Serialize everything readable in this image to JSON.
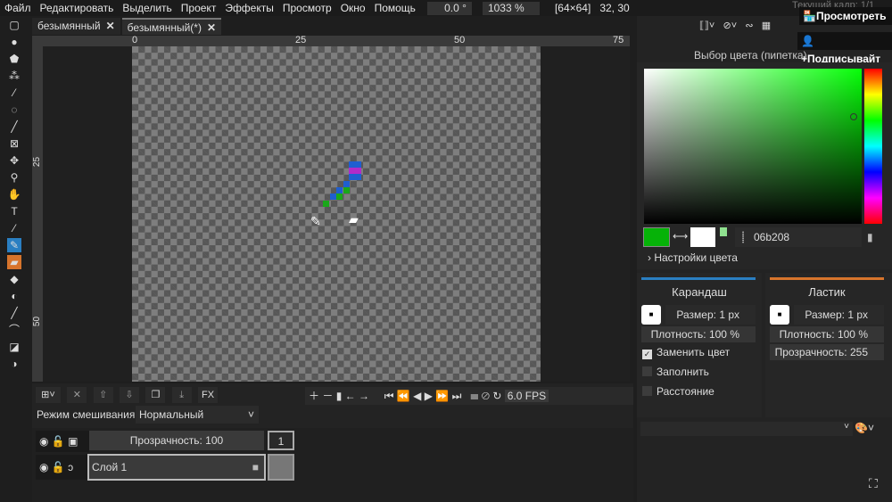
{
  "menu": [
    "Файл",
    "Редактировать",
    "Выделить",
    "Проект",
    "Эффекты",
    "Просмотр",
    "Окно",
    "Помощь"
  ],
  "rotation": "0.0 °",
  "zoom": "1033 %",
  "canvas_size": "[64×64]",
  "cursor_pos": "32, 30",
  "tabs": [
    {
      "label": "безымянный"
    },
    {
      "label": "безымянный(*)"
    }
  ],
  "ruler": {
    "top": [
      "0",
      "25",
      "50",
      "75"
    ],
    "left": [
      "25",
      "50"
    ]
  },
  "timeline": {
    "fx": "FX",
    "blend_label": "Режим смешивания:",
    "blend_value": "Нормальный",
    "opacity": "Прозрачность: 100",
    "frame": "1",
    "layer": "Слой 1",
    "fps": "6.0 FPS"
  },
  "overlay": {
    "current_frame": "Текущий кадр: 1/1",
    "view": "Просмотреть",
    "subscribe": "Подписывайт"
  },
  "color": {
    "title": "Выбор цвета (пипетка)",
    "hex": "06b208",
    "settings": "Настройки цвета",
    "primary": "#06b208",
    "secondary": "#ffffff"
  },
  "pencil": {
    "title": "Карандаш",
    "size": "Размер: 1 px",
    "density": "Плотность: 100 %",
    "replace": "Заменить цвет",
    "fill": "Заполнить",
    "distance": "Расстояние",
    "accent": "#2a7fc2"
  },
  "eraser": {
    "title": "Ластик",
    "size": "Размер: 1 px",
    "density": "Плотность: 100 %",
    "opacity": "Прозрачность: 255",
    "accent": "#d7742c"
  }
}
